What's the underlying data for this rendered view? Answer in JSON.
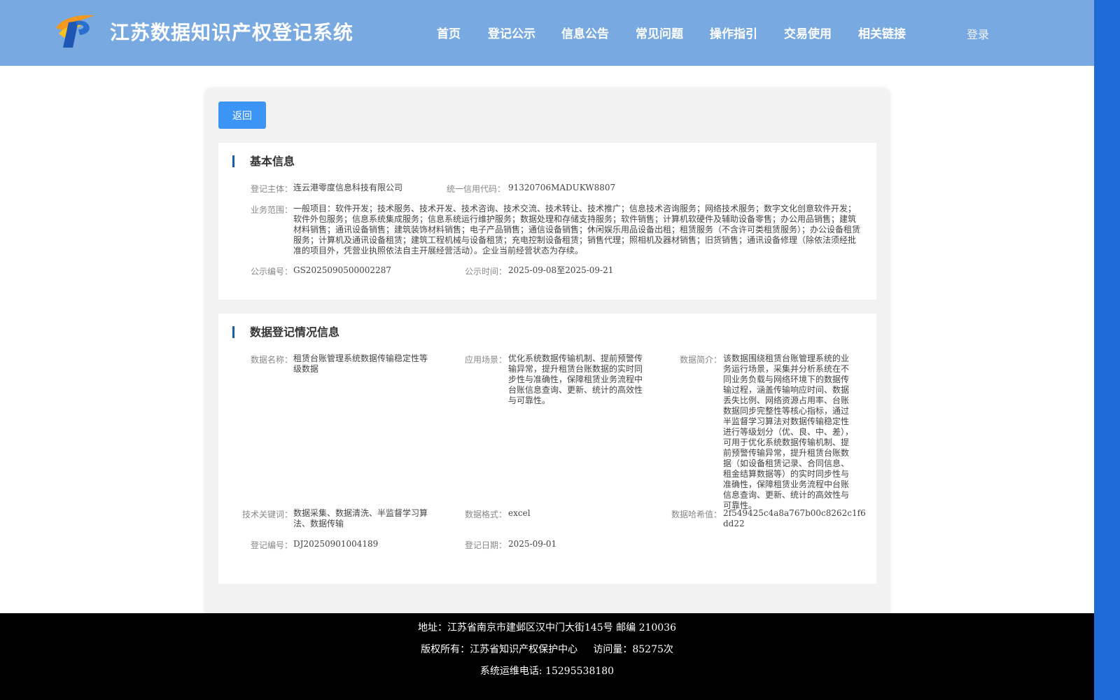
{
  "header": {
    "site_title": "江苏数据知识产权登记系统",
    "nav": [
      "首页",
      "登记公示",
      "信息公告",
      "常见问题",
      "操作指引",
      "交易使用",
      "相关链接"
    ],
    "login_label": "登录"
  },
  "back_label": "返回",
  "basic": {
    "title": "基本信息",
    "subject_label": "登记主体：",
    "subject": "连云港零度信息科技有限公司",
    "credit_label": "统一信用代码：",
    "credit": "91320706MADUKW8807",
    "scope_label": "业务范围：",
    "scope": "一般项目：软件开发；技术服务、技术开发、技术咨询、技术交流、技术转让、技术推广；信息技术咨询服务；网络技术服务；数字文化创意软件开发；软件外包服务；信息系统集成服务；信息系统运行维护服务；数据处理和存储支持服务；软件销售；计算机软硬件及辅助设备零售；办公用品销售；建筑材料销售；通讯设备销售；建筑装饰材料销售；电子产品销售；通信设备销售；休闲娱乐用品设备出租；租赁服务（不含许可类租赁服务）；办公设备租赁服务；计算机及通讯设备租赁；建筑工程机械与设备租赁；充电控制设备租赁；销售代理；照相机及器材销售；旧货销售；通讯设备修理（除依法须经批准的项目外，凭营业执照依法自主开展经营活动）。企业当前经营状态为存续。",
    "pub_no_label": "公示编号：",
    "pub_no": "GS2025090500002287",
    "pub_time_label": "公示时间：",
    "pub_time": "2025-09-08至2025-09-21"
  },
  "data": {
    "title": "数据登记情况信息",
    "name_label": "数据名称：",
    "name": "租赁台账管理系统数据传输稳定性等级数据",
    "scene_label": "应用场景：",
    "scene": "优化系统数据传输机制、提前预警传输异常，提升租赁台账数据的实时同步性与准确性，保障租赁业务流程中台账信息查询、更新、统计的高效性与可靠性。",
    "intro_label": "数据简介：",
    "intro": "该数据围绕租赁台账管理系统的业务运行场景，采集并分析系统在不同业务负载与网络环境下的数据传输过程，涵盖传输响应时间、数据丢失比例、网络资源占用率、台账数据同步完整性等核心指标，通过半监督学习算法对数据传输稳定性进行等级划分（优、良、中、差），可用于优化系统数据传输机制、提前预警传输异常，提升租赁台账数据（如设备租赁记录、合同信息、租金结算数据等）的实时同步性与准确性，保障租赁业务流程中台账信息查询、更新、统计的高效性与可靠性。",
    "keywords_label": "技术关键词：",
    "keywords": "数据采集、数据清洗、半监督学习算法、数据传输",
    "format_label": "数据格式：",
    "format": "excel",
    "hash_label": "数据哈希值：",
    "hash": "2f549425c4a8a767b00c8262c1f6dd22",
    "reg_no_label": "登记编号：",
    "reg_no": "DJ20250901004189",
    "reg_date_label": "登记日期：",
    "reg_date": "2025-09-01"
  },
  "footer": {
    "address": "地址：江苏省南京市建邺区汉中门大街145号 邮编 210036",
    "copyright": "版权所有：江苏省知识产权保护中心     访问量：85275次",
    "phone": "系统运维电话: 15295538180"
  }
}
